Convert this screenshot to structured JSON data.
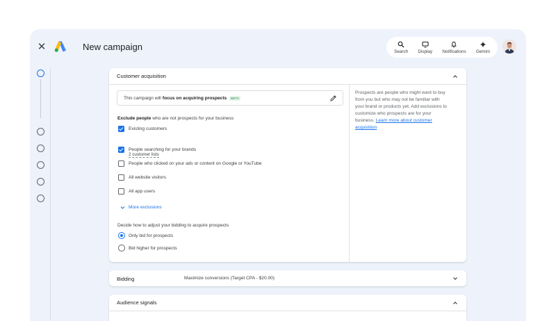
{
  "app": {
    "title": "New campaign",
    "brand_colors": [
      "#fbbc04",
      "#4285f4",
      "#34a853"
    ]
  },
  "toolbar": {
    "items": [
      {
        "label": "Search",
        "icon": "search-icon"
      },
      {
        "label": "Display",
        "icon": "display-icon"
      },
      {
        "label": "Notifications",
        "icon": "bell-icon"
      },
      {
        "label": "Gemini",
        "icon": "gemini-sparkle-icon"
      }
    ]
  },
  "steps": {
    "count": 6,
    "active_index": 0
  },
  "customer_acquisition": {
    "title": "Customer acquisition",
    "focus_prefix": "This campaign will",
    "focus_bold": "focus on acquiring prospects",
    "beta": "BETA",
    "exclude_bold": "Exclude people",
    "exclude_rest": "who are not prospects for your business",
    "checkboxes": [
      {
        "label": "Existing customers",
        "checked": true
      },
      {
        "label": "People searching for your brands",
        "checked": true
      },
      {
        "label": "People who clicked on your ads or content on Google or YouTube",
        "checked": false
      },
      {
        "label": "All website visitors",
        "checked": false
      },
      {
        "label": "All app users",
        "checked": false
      }
    ],
    "customer_lists": "2 customer lists",
    "more_exclusions": "More exclusions",
    "bidding_question": "Decide how to adjust your bidding to acquire prospects",
    "radios": [
      {
        "label": "Only bid for prospects",
        "selected": true
      },
      {
        "label": "Bid higher for prospects",
        "selected": false
      }
    ],
    "help_text": "Prospects are people who might want to buy from you but who may not be familiar with your brand or products yet. Add exclusions to customize who prospects are for your business.",
    "help_link": "Learn more about customer acquisition"
  },
  "bidding": {
    "title": "Bidding",
    "value": "Maximize conversions (Target CPA - $20.00)"
  },
  "audience": {
    "title": "Audience signals"
  }
}
